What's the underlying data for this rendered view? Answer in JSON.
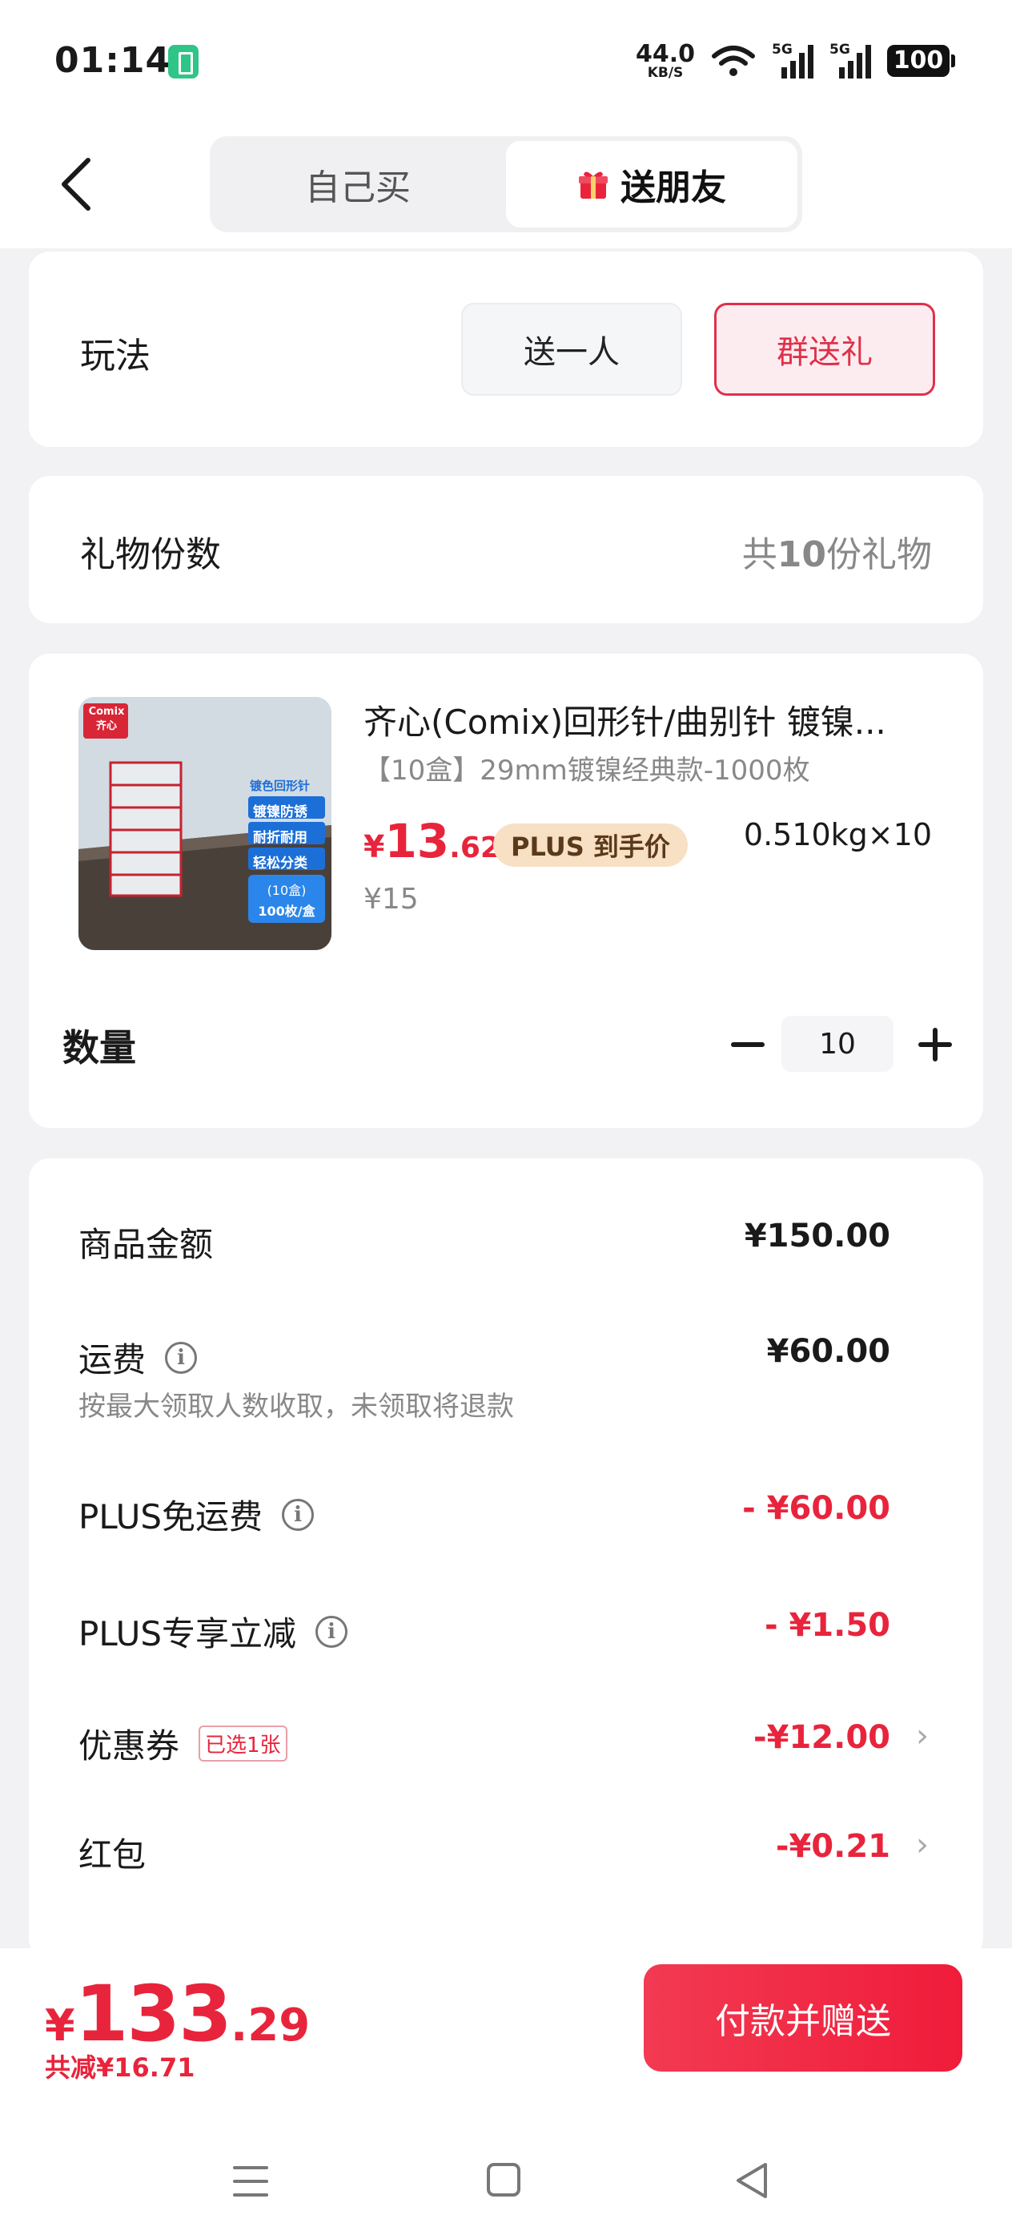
{
  "status": {
    "time": "01:14",
    "net_speed_value": "44.0",
    "net_speed_unit": "KB/S",
    "sig1_tag": "5G",
    "sig2_tag": "5G",
    "battery": "100"
  },
  "header": {
    "tab_self": "自己买",
    "tab_gift": "送朋友"
  },
  "play": {
    "label": "玩法",
    "opt_single": "送一人",
    "opt_group": "群送礼"
  },
  "gift_count": {
    "label": "礼物份数",
    "prefix": "共",
    "count": "10",
    "suffix": "份礼物"
  },
  "product": {
    "title": "齐心(Comix)回形针/曲别针 镀镍...",
    "spec": "【10盒】29mm镀镍经典款-1000枚",
    "price_currency": "¥",
    "price_int": "13",
    "price_dec": ".62",
    "plus_badge": "PLUS 到手价",
    "weight": "0.510kg×10",
    "orig_price": "¥15",
    "img_brand": "Comix",
    "img_brand2": "齐心",
    "img_lines": [
      "镀色回形针",
      "镀镍防锈",
      "耐折耐用",
      "轻松分类",
      "(10盒)",
      "100枚/盒"
    ],
    "qty_label": "数量",
    "qty_value": "10"
  },
  "summary": {
    "goods_label": "商品金额",
    "goods_value": "¥150.00",
    "ship_label": "运费",
    "ship_value": "¥60.00",
    "ship_note": "按最大领取人数收取，未领取将退款",
    "plus_free_label": "PLUS免运费",
    "plus_free_value": "- ¥60.00",
    "plus_off_label": "PLUS专享立减",
    "plus_off_value": "- ¥1.50",
    "coupon_label": "优惠券",
    "coupon_tag": "已选1张",
    "coupon_value": "-¥12.00",
    "redpack_label": "红包",
    "redpack_value": "-¥0.21"
  },
  "footer": {
    "total_currency": "¥",
    "total_int": "133",
    "total_dec": ".29",
    "saved": "共减¥16.71",
    "pay_button": "付款并赠送"
  },
  "colors": {
    "accent_red": "#e8243c",
    "plus_gold": "#f7e0c4"
  }
}
